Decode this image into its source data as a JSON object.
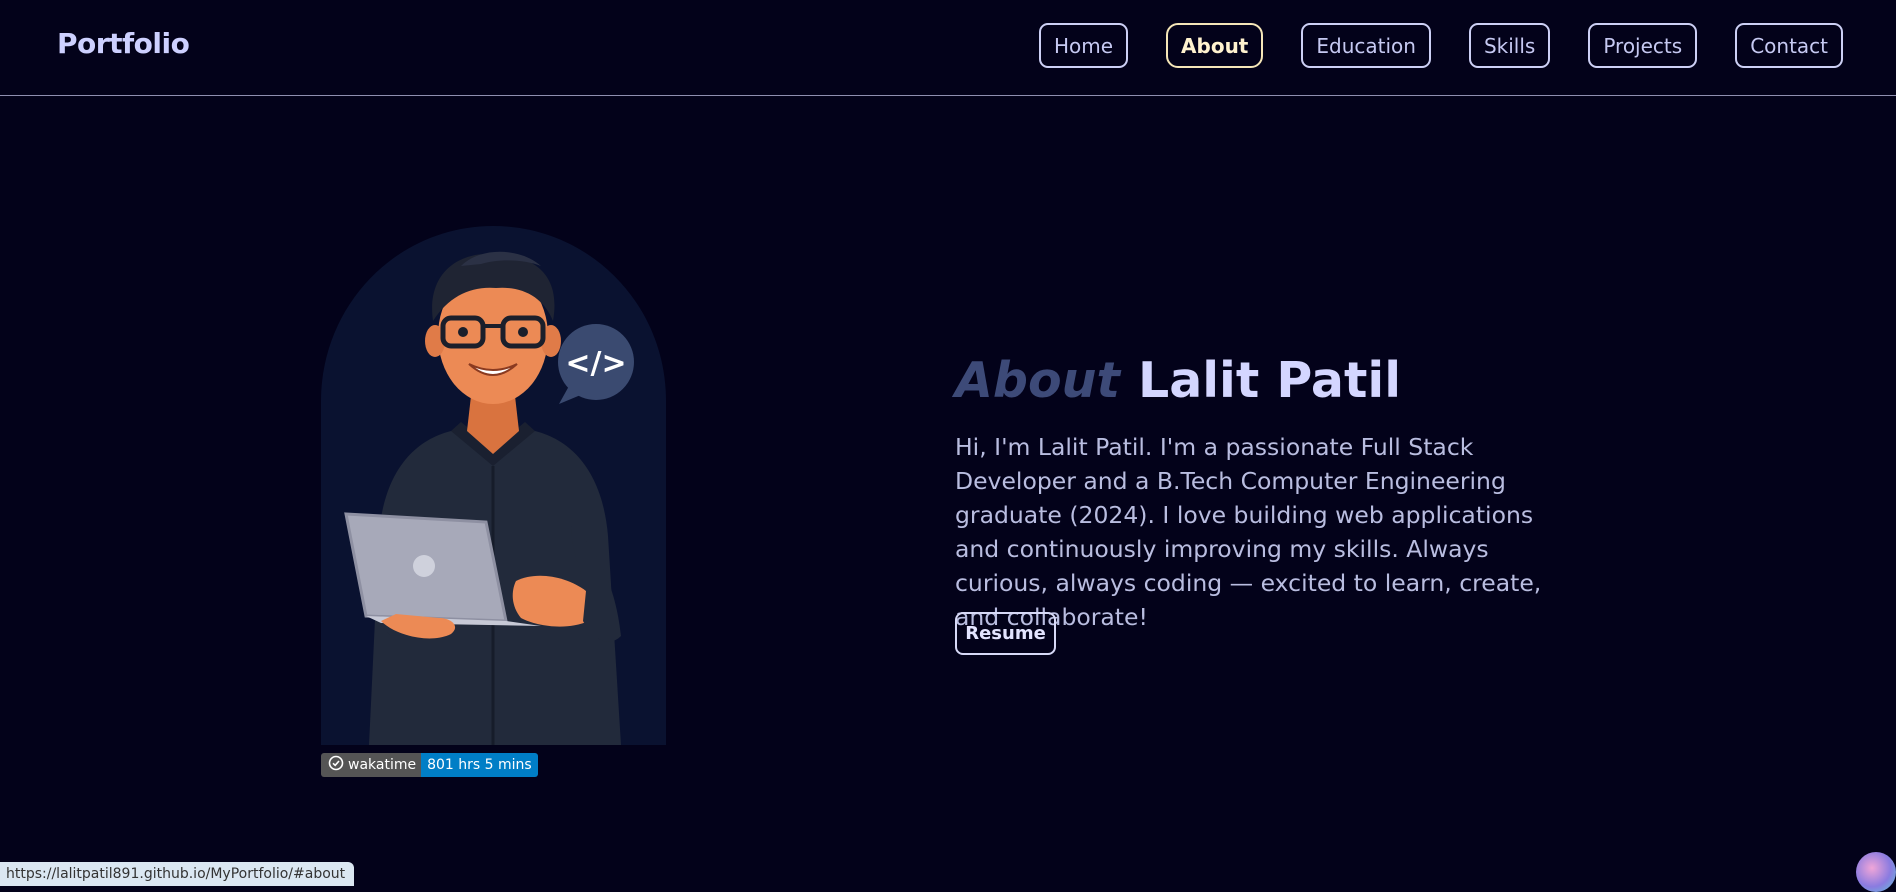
{
  "header": {
    "brand": "Portfolio",
    "nav": [
      {
        "label": "Home",
        "active": false
      },
      {
        "label": "About",
        "active": true
      },
      {
        "label": "Education",
        "active": false
      },
      {
        "label": "Skills",
        "active": false
      },
      {
        "label": "Projects",
        "active": false
      },
      {
        "label": "Contact",
        "active": false
      }
    ]
  },
  "about": {
    "title_word": "About",
    "name": "Lalit Patil",
    "description": "Hi, I'm Lalit Patil. I'm a passionate Full Stack Developer and a B.Tech Computer Engineering graduate (2024). I love building web applications and continuously improving my skills. Always curious, always coding — excited to learn, create, and collaborate!",
    "resume_label": "Resume"
  },
  "illustration": {
    "code_bubble": "</>"
  },
  "wakatime": {
    "label": "wakatime",
    "value": "801 hrs 5 mins"
  },
  "status_bar": {
    "url": "https://lalitpatil891.github.io/MyPortfolio/#about"
  },
  "colors": {
    "background": "#03021a",
    "accent": "#cdd0ff",
    "active_nav": "#f5e6b8",
    "badge_blue": "#007ec6"
  }
}
